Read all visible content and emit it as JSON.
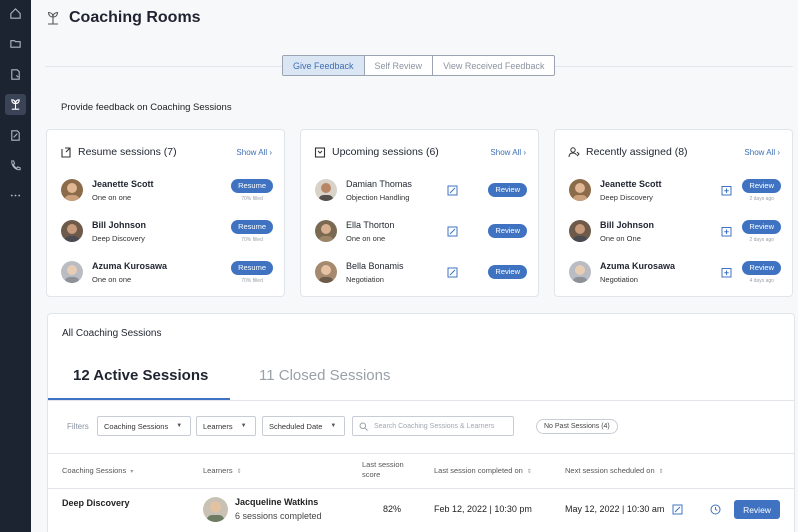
{
  "sidebar": {
    "icons": [
      "home-icon",
      "folder-icon",
      "document-icon",
      "coaching-icon",
      "edit-document-icon",
      "phone-icon",
      "more-icon"
    ],
    "active": "coaching-icon"
  },
  "header": {
    "title": "Coaching Rooms",
    "icon": "coaching-icon"
  },
  "tabs": [
    {
      "label": "Give Feedback",
      "active": true
    },
    {
      "label": "Self Review",
      "active": false
    },
    {
      "label": "View Received Feedback",
      "active": false
    }
  ],
  "provide_label": "Provide feedback on Coaching Sessions",
  "cards": {
    "resume": {
      "title": "Resume sessions (7)",
      "show_all": "Show All",
      "items": [
        {
          "name": "Jeanette Scott",
          "sub": "One on one",
          "action": "Resume",
          "meta": "70% filled"
        },
        {
          "name": "Bill Johnson",
          "sub": "Deep Discovery",
          "action": "Resume",
          "meta": "70% filled"
        },
        {
          "name": "Azuma Kurosawa",
          "sub": "One on one",
          "action": "Resume",
          "meta": "70% filled"
        }
      ]
    },
    "upcoming": {
      "title": "Upcoming sessions (6)",
      "show_all": "Show All",
      "items": [
        {
          "name": "Damian Thomas",
          "sub": "Objection Handling",
          "action": "Review"
        },
        {
          "name": "Ella Thorton",
          "sub": "One on one",
          "action": "Review"
        },
        {
          "name": "Bella Bonamis",
          "sub": "Negotiation",
          "action": "Review"
        }
      ]
    },
    "recent": {
      "title": "Recently assigned (8)",
      "show_all": "Show All",
      "items": [
        {
          "name": "Jeanette Scott",
          "sub": "Deep Discovery",
          "action": "Review",
          "meta": "2 days ago"
        },
        {
          "name": "Bill Johnson",
          "sub": "One on One",
          "action": "Review",
          "meta": "2 days ago"
        },
        {
          "name": "Azuma Kurosawa",
          "sub": "Negotiation",
          "action": "Review",
          "meta": "4 days ago"
        }
      ]
    }
  },
  "all_sessions": {
    "title": "All Coaching Sessions",
    "tab_active": "12 Active Sessions",
    "tab_inactive": "11 Closed Sessions",
    "filters_label": "Filters",
    "filters": [
      "Coaching Sessions",
      "Learners",
      "Scheduled Date"
    ],
    "search_placeholder": "Search Coaching Sessions & Learners",
    "chip": "No Past Sessions (4)",
    "columns": [
      "Coaching Sessions",
      "Learners",
      "Last session score",
      "Last session completed on",
      "Next session scheduled on"
    ],
    "rows": [
      {
        "session": "Deep Discovery",
        "learner": "Jacqueline Watkins",
        "learner_sub": "6 sessions completed",
        "score": "82%",
        "last": "Feb 12, 2022 | 10:30 pm",
        "next": "May 12, 2022 | 10:30 am",
        "action": "Review"
      }
    ]
  },
  "colors": {
    "accent": "#3f73c1",
    "sidebar": "#1c2331"
  }
}
